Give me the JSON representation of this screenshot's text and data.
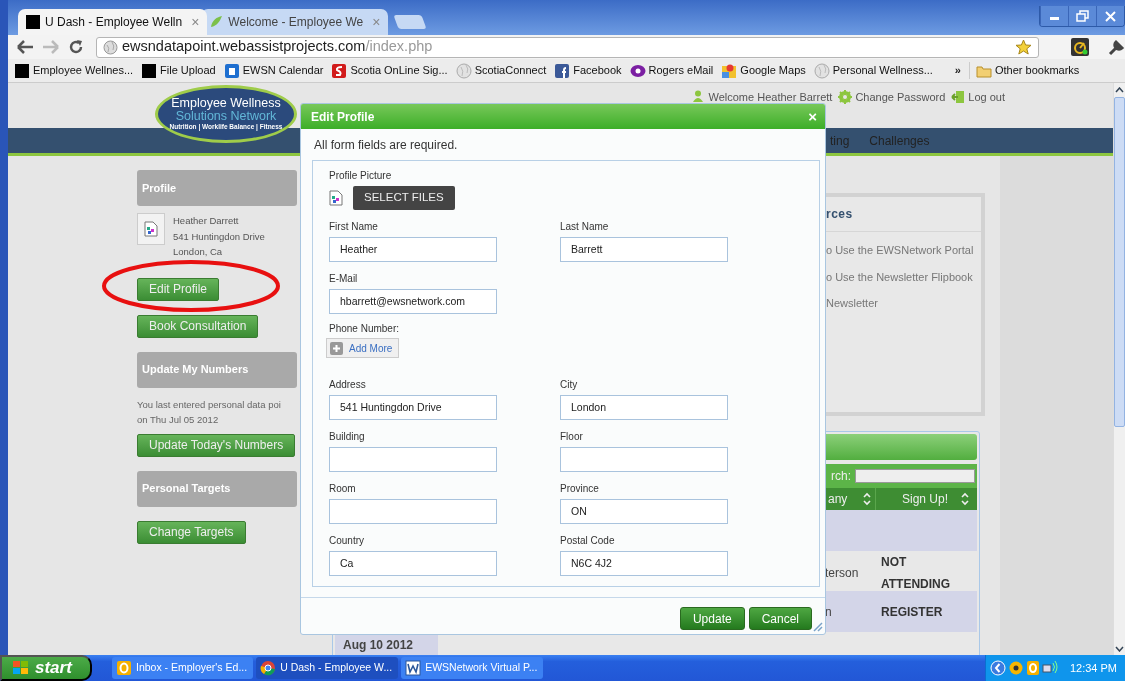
{
  "browser": {
    "tabs": [
      {
        "title": "U Dash - Employee Welln",
        "close": "×",
        "selected": true
      },
      {
        "title": "Welcome - Employee We",
        "close": "×",
        "selected": false
      }
    ],
    "address": {
      "host": "ewsndatapoint.webassistprojects.com",
      "path": "/index.php"
    },
    "bookmarks": [
      {
        "kind": "blank",
        "label": "Employee Wellnes..."
      },
      {
        "kind": "blank",
        "label": "File Upload"
      },
      {
        "kind": "calendar",
        "label": "EWSN Calendar"
      },
      {
        "kind": "bank",
        "label": "Scotia OnLine Sig..."
      },
      {
        "kind": "globe",
        "label": "ScotiaConnect"
      },
      {
        "kind": "social",
        "label": "Facebook"
      },
      {
        "kind": "mail",
        "label": "Rogers eMail"
      },
      {
        "kind": "map",
        "label": "Google Maps"
      },
      {
        "kind": "globe",
        "label": "Personal Wellness..."
      }
    ],
    "overflow": "»",
    "other_bookmarks": "Other bookmarks"
  },
  "site": {
    "logo": {
      "line1": "Employee Wellness",
      "line2": "Solutions Network",
      "tagline": "Nutrition | Worklife Balance | Fitness"
    },
    "user_links": [
      {
        "kind": "user",
        "label": "Welcome Heather Barrett"
      },
      {
        "kind": "settings",
        "label": "Change Password"
      },
      {
        "kind": "logout",
        "label": "Log out"
      }
    ],
    "nav": [
      "ting",
      "Challenges"
    ],
    "sidebar": [
      {
        "kind": "heading",
        "text": "Profile"
      },
      {
        "kind": "profile",
        "lines": [
          "Heather Darrett",
          "541 Huntingdon Drive",
          "London, Ca"
        ]
      },
      {
        "kind": "button",
        "text": "Edit Profile"
      },
      {
        "kind": "button",
        "text": "Book Consultation"
      },
      {
        "kind": "heading",
        "text": "Update My Numbers"
      },
      {
        "kind": "note",
        "lines": [
          "You last entered personal data poi",
          "on Thu Jul 05 2012"
        ]
      },
      {
        "kind": "button",
        "text": "Update Today's Numbers"
      },
      {
        "kind": "heading",
        "text": "Personal Targets"
      },
      {
        "kind": "button",
        "text": "Change Targets"
      }
    ],
    "resources": {
      "title": "rces",
      "links": [
        "o Use the EWSNetwork Portal",
        "o Use the Newsletter Flipbook",
        "Newsletter"
      ]
    },
    "events": {
      "search_label": "rch:",
      "columns": [
        "any",
        "Sign Up!"
      ],
      "rows": [
        {},
        {
          "column_3": "terson",
          "signup": "NOT ATTENDING"
        },
        {
          "column_3": "n",
          "signup": "REGISTER"
        },
        {
          "date": "Aug 10 2012"
        }
      ]
    }
  },
  "dialog": {
    "title": "Edit Profile",
    "close": "×",
    "intro": "All form fields are required.",
    "picture_label": "Profile Picture",
    "select_button": "SELECT FILES",
    "rows": [
      {
        "fields": [
          {
            "kind": "input",
            "label": "First Name",
            "value": "Heather"
          },
          {
            "kind": "input",
            "label": "Last Name",
            "value": "Barrett"
          }
        ]
      },
      {
        "fields": [
          {
            "kind": "input",
            "label": "E-Mail",
            "value": "hbarrett@ewsnetwork.com"
          }
        ]
      },
      {
        "fields": [
          {
            "kind": "add",
            "label": "Phone Number:",
            "button": "Add More"
          }
        ]
      },
      {
        "fields": [
          {
            "kind": "input",
            "label": "Address",
            "value": "541 Huntingdon Drive"
          },
          {
            "kind": "input",
            "label": "City",
            "value": "London"
          }
        ]
      },
      {
        "fields": [
          {
            "kind": "input",
            "label": "Building"
          },
          {
            "kind": "input",
            "label": "Floor"
          }
        ]
      },
      {
        "fields": [
          {
            "kind": "input",
            "label": "Room"
          },
          {
            "kind": "input",
            "label": "Province",
            "value": "ON"
          }
        ]
      },
      {
        "fields": [
          {
            "kind": "input",
            "label": "Country",
            "value": "Ca"
          },
          {
            "kind": "input",
            "label": "Postal Code",
            "value": "N6C 4J2"
          }
        ]
      }
    ],
    "buttons": [
      "Update",
      "Cancel"
    ]
  },
  "taskbar": {
    "start": "start",
    "items": [
      {
        "kind": "mail",
        "label": "Inbox - Employer's Ed...",
        "selected": false
      },
      {
        "kind": "browser",
        "label": "U Dash - Employee W...",
        "selected": true
      },
      {
        "kind": "document",
        "label": "EWSNetwork Virtual P...",
        "selected": false
      }
    ],
    "clock": "12:34 PM"
  }
}
